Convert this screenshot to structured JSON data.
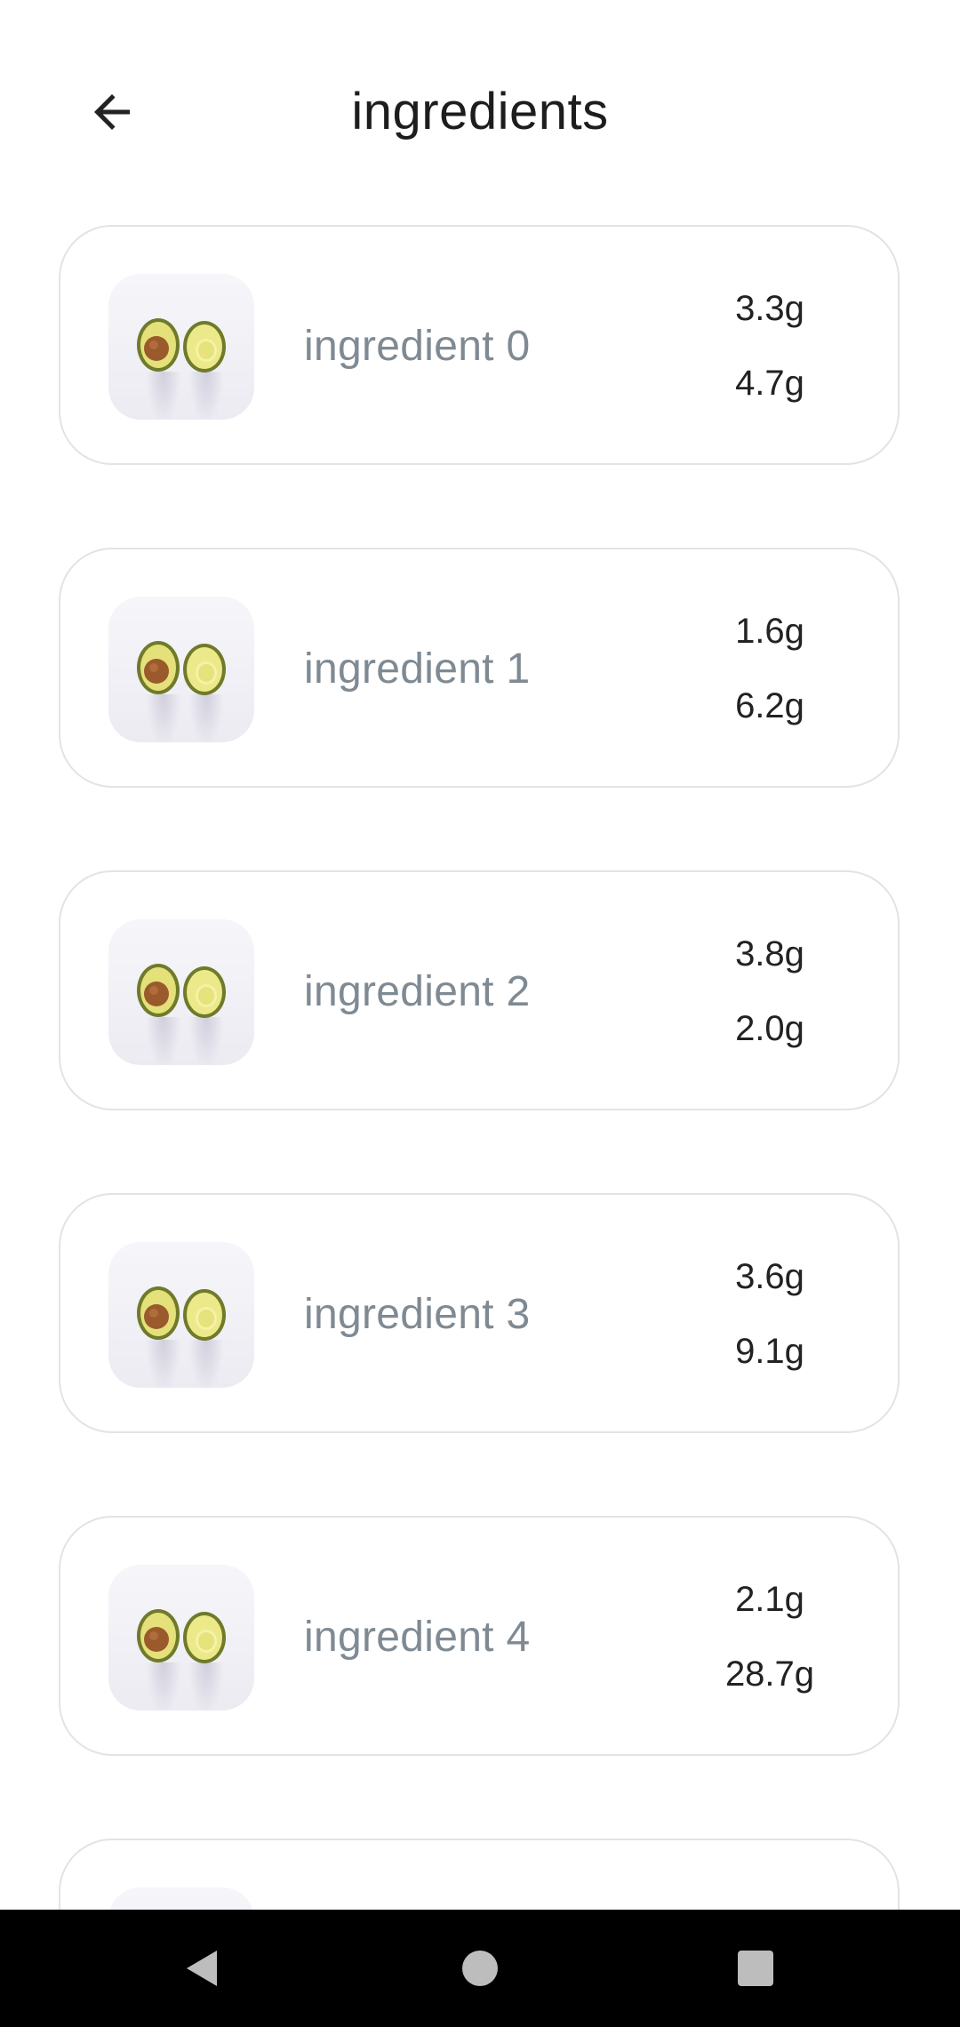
{
  "header": {
    "title": "ingredients"
  },
  "ingredients": [
    {
      "name": "ingredient 0",
      "value1": "3.3g",
      "value2": "4.7g"
    },
    {
      "name": "ingredient 1",
      "value1": "1.6g",
      "value2": "6.2g"
    },
    {
      "name": "ingredient 2",
      "value1": "3.8g",
      "value2": "2.0g"
    },
    {
      "name": "ingredient 3",
      "value1": "3.6g",
      "value2": "9.1g"
    },
    {
      "name": "ingredient 4",
      "value1": "2.1g",
      "value2": "28.7g"
    },
    {
      "name": "",
      "value1": "",
      "value2": ""
    }
  ],
  "icons": {
    "back": "arrow-left-icon",
    "thumbnail": "avocado-image",
    "nav_back": "triangle-back-icon",
    "nav_home": "circle-home-icon",
    "nav_recents": "square-recents-icon"
  },
  "colors": {
    "background": "#ffffff",
    "title": "#1d1d1d",
    "ingredient_name": "#7f8a93",
    "value_text": "#222222",
    "card_border": "#e3e3e3",
    "navbar": "#000000",
    "nav_icons": "#bdbdbd"
  }
}
